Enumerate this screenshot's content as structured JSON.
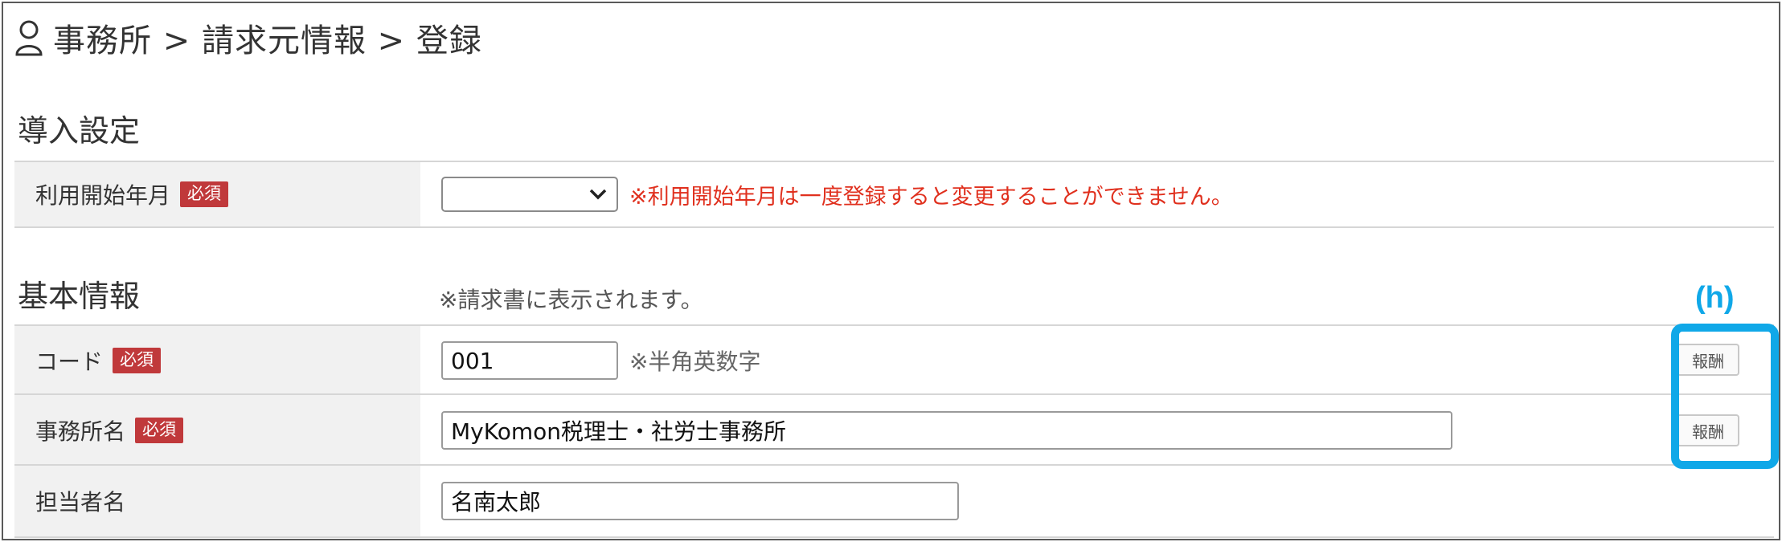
{
  "header": {
    "title": "事務所 > 請求元情報 > 登録"
  },
  "intro_section": {
    "title": "導入設定",
    "start_month": {
      "label": "利用開始年月",
      "required": "必須",
      "value": "",
      "warning": "※利用開始年月は一度登録すると変更することができません。"
    }
  },
  "basic_section": {
    "title": "基本情報",
    "note": "※請求書に表示されます。",
    "code": {
      "label": "コード",
      "required": "必須",
      "value": "001",
      "hint": "※半角英数字",
      "button": "報酬"
    },
    "office_name": {
      "label": "事務所名",
      "required": "必須",
      "value": "MyKomon税理士・社労士事務所",
      "button": "報酬"
    },
    "person_in_charge": {
      "label": "担当者名",
      "value": "名南太郎"
    }
  },
  "annotation": {
    "label": "(h)",
    "color": "#10a8e8"
  }
}
